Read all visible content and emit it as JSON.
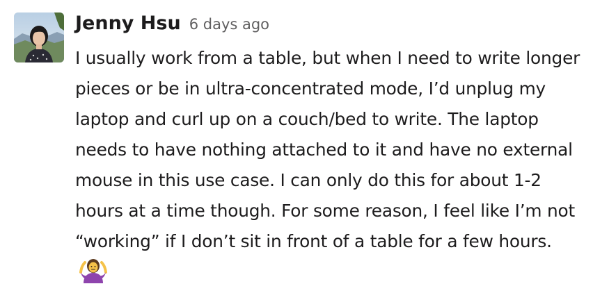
{
  "message": {
    "author": "Jenny Hsu",
    "timestamp": "6 days ago",
    "text": "I usually work from a table, but when I need to write longer pieces or be in ultra-concentrated mode, I’d unplug my laptop and curl up on a couch/bed to write. The laptop needs to have nothing attached to it and have no external mouse in this use case. I can only do this for about 1-2 hours at a time though. For some reason, I feel like I’m not “working” if I don’t sit in front of a table for a few hours.",
    "emoji": "person-shrugging-icon"
  },
  "colors": {
    "text": "#1d1c1d",
    "timestamp": "#616061",
    "emoji_purple": "#8e44ad"
  }
}
